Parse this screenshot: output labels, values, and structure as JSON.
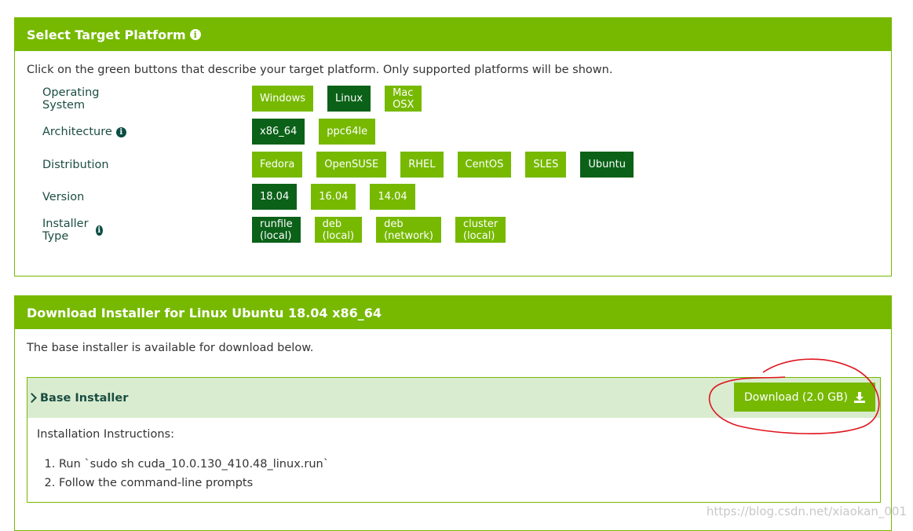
{
  "platform": {
    "title": "Select Target Platform",
    "description": "Click on the green buttons that describe your target platform. Only supported platforms will be shown.",
    "rows": [
      {
        "label": "Operating System",
        "info": false,
        "options": [
          "Windows",
          "Linux",
          "Mac OSX"
        ],
        "selected": "Linux"
      },
      {
        "label": "Architecture",
        "info": true,
        "options": [
          "x86_64",
          "ppc64le"
        ],
        "selected": "x86_64"
      },
      {
        "label": "Distribution",
        "info": false,
        "options": [
          "Fedora",
          "OpenSUSE",
          "RHEL",
          "CentOS",
          "SLES",
          "Ubuntu"
        ],
        "selected": "Ubuntu"
      },
      {
        "label": "Version",
        "info": false,
        "options": [
          "18.04",
          "16.04",
          "14.04"
        ],
        "selected": "18.04"
      },
      {
        "label": "Installer Type",
        "info": true,
        "options": [
          "runfile (local)",
          "deb (local)",
          "deb (network)",
          "cluster (local)"
        ],
        "selected": "runfile (local)"
      }
    ]
  },
  "download": {
    "title": "Download Installer for Linux Ubuntu 18.04 x86_64",
    "description": "The base installer is available for download below.",
    "base_installer": {
      "title": "Base Installer",
      "download_label": "Download (2.0 GB)",
      "instructions_title": "Installation Instructions:",
      "steps": [
        "Run `sudo sh cuda_10.0.130_410.48_linux.run`",
        "Follow the command-line prompts"
      ]
    }
  },
  "watermark": "https://blog.csdn.net/xiaokan_001",
  "colors": {
    "brand_green": "#76b900",
    "selected_green": "#0b6118",
    "label_teal": "#1b4d42",
    "highlight_bg": "#d9ecd0",
    "annotation_red": "#e0141e"
  },
  "icons": {
    "info": "info-circle-icon",
    "expand": "chevron-right-icon",
    "download": "download-icon"
  }
}
